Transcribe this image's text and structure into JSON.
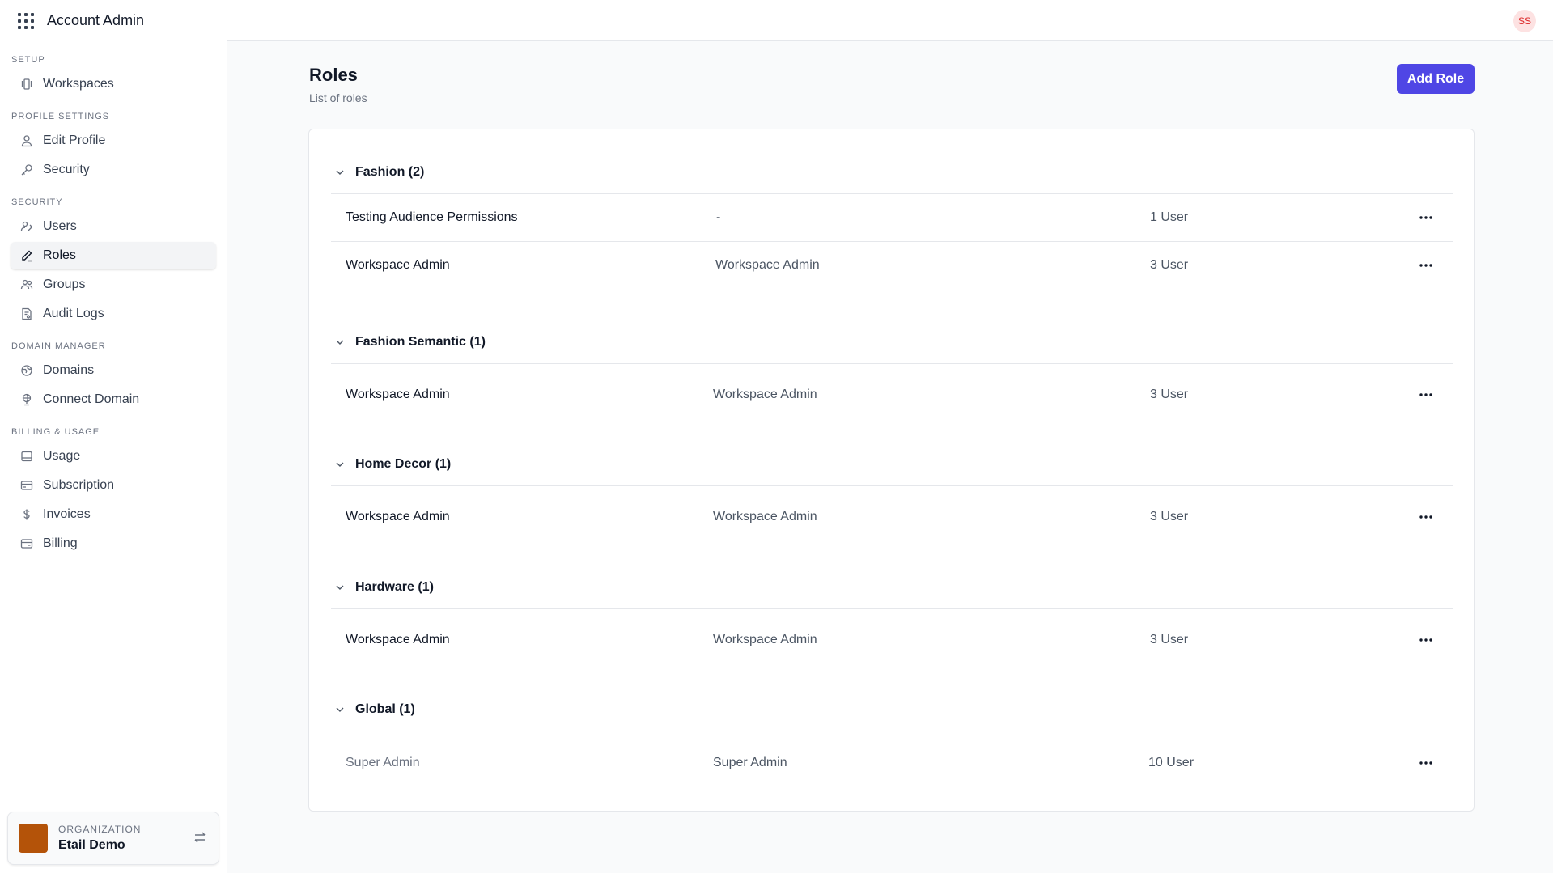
{
  "app": {
    "title": "Account Admin"
  },
  "sidebar": {
    "sections": [
      {
        "heading": "SETUP",
        "items": [
          {
            "label": "Workspaces",
            "icon": "workspaces-icon"
          }
        ]
      },
      {
        "heading": "PROFILE SETTINGS",
        "items": [
          {
            "label": "Edit Profile",
            "icon": "user-icon"
          },
          {
            "label": "Security",
            "icon": "key-icon"
          }
        ]
      },
      {
        "heading": "SECURITY",
        "items": [
          {
            "label": "Users",
            "icon": "users-icon"
          },
          {
            "label": "Roles",
            "icon": "pencil-icon",
            "active": true
          },
          {
            "label": "Groups",
            "icon": "group-icon"
          },
          {
            "label": "Audit Logs",
            "icon": "audit-icon"
          }
        ]
      },
      {
        "heading": "DOMAIN MANAGER",
        "items": [
          {
            "label": "Domains",
            "icon": "globe-icon"
          },
          {
            "label": "Connect Domain",
            "icon": "connect-globe-icon"
          }
        ]
      },
      {
        "heading": "BILLING & USAGE",
        "items": [
          {
            "label": "Usage",
            "icon": "usage-icon"
          },
          {
            "label": "Subscription",
            "icon": "subscription-icon"
          },
          {
            "label": "Invoices",
            "icon": "dollar-icon"
          },
          {
            "label": "Billing",
            "icon": "billing-icon"
          }
        ]
      }
    ],
    "organization": {
      "label": "ORGANIZATION",
      "name": "Etail Demo",
      "avatar_color": "#b45309"
    }
  },
  "topbar": {
    "user_initials": "SS"
  },
  "main": {
    "title": "Roles",
    "subtitle": "List of roles",
    "add_button": "Add Role",
    "accent_color": "#4f46e5",
    "groups": [
      {
        "name": "Fashion (2)",
        "rows": [
          {
            "name": "Testing Audience Permissions",
            "description": "-",
            "users": "1 User"
          },
          {
            "name": "Workspace Admin",
            "description": "Workspace Admin",
            "users": "3 User"
          }
        ]
      },
      {
        "name": "Fashion Semantic (1)",
        "rows": [
          {
            "name": "Workspace Admin",
            "description": "Workspace Admin",
            "users": "3 User"
          }
        ]
      },
      {
        "name": "Home Decor (1)",
        "rows": [
          {
            "name": "Workspace Admin",
            "description": "Workspace Admin",
            "users": "3 User"
          }
        ]
      },
      {
        "name": "Hardware (1)",
        "rows": [
          {
            "name": "Workspace Admin",
            "description": "Workspace Admin",
            "users": "3 User"
          }
        ]
      },
      {
        "name": "Global (1)",
        "rows": [
          {
            "name": "Super Admin",
            "description": "Super Admin",
            "users": "10 User"
          }
        ]
      }
    ]
  }
}
